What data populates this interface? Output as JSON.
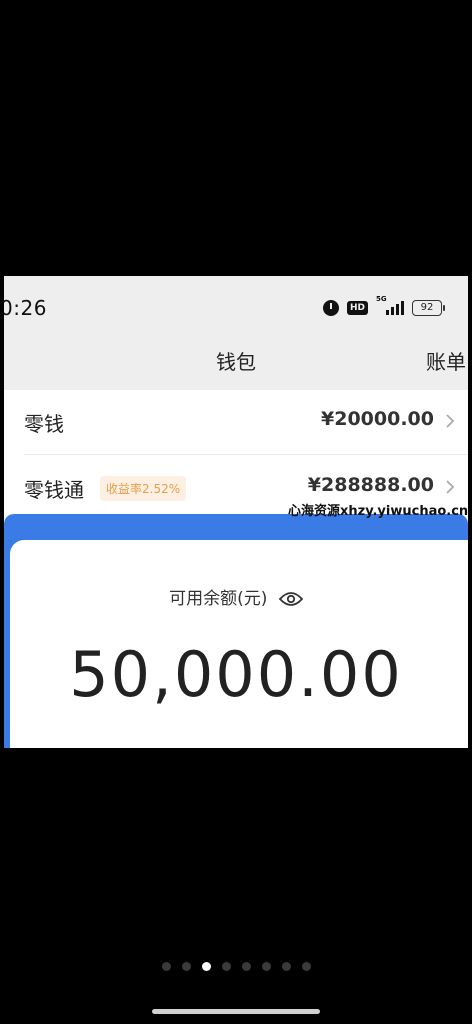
{
  "status_bar": {
    "time": "0:26",
    "network": "5G",
    "battery": "92",
    "icons": [
      "alarm-icon",
      "hd-icon",
      "signal-icon",
      "battery-icon"
    ]
  },
  "nav": {
    "title": "钱包",
    "right_label": "账单"
  },
  "rows": [
    {
      "label": "零钱",
      "amount": "¥20000.00"
    },
    {
      "label": "零钱通",
      "badge": "收益率2.52%",
      "amount": "¥288888.00"
    }
  ],
  "watermark": "心海资源xhzy.yiwuchao.cn",
  "balance": {
    "label": "可用余额(元)",
    "value": "50,000.00"
  },
  "pager": {
    "count": 8,
    "active_index": 2
  },
  "colors": {
    "accent": "#3b7be6",
    "badge_bg": "#fdf0e2",
    "badge_text": "#e0a050"
  }
}
